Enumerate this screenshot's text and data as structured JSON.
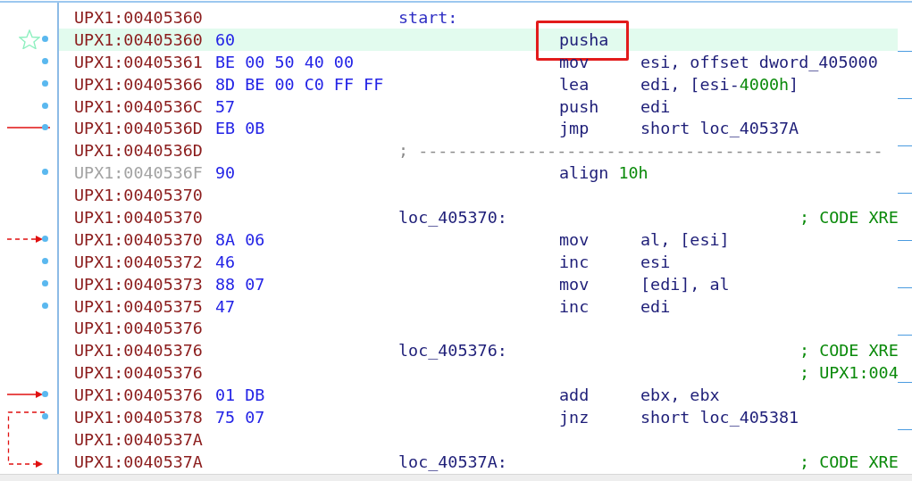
{
  "listing": {
    "rows": [
      {
        "address": "UPX1:00405360",
        "label": "start:"
      },
      {
        "address": "UPX1:00405360",
        "bytes": "60",
        "mnemonic": "pusha",
        "highlighted": true,
        "boxed": true,
        "star": true,
        "dot": true
      },
      {
        "address": "UPX1:00405361",
        "bytes": "BE 00 50 40 00",
        "mnemonic": "mov",
        "operands": [
          {
            "text": "esi, offset dword_405000"
          }
        ],
        "dot": true
      },
      {
        "address": "UPX1:00405366",
        "bytes": "8D BE 00 C0 FF FF",
        "mnemonic": "lea",
        "operands": [
          {
            "text": "edi, [esi-"
          },
          {
            "text": "4000h",
            "kind": "number"
          },
          {
            "text": "]"
          }
        ],
        "dot": true
      },
      {
        "address": "UPX1:0040536C",
        "bytes": "57",
        "mnemonic": "push",
        "operands": [
          {
            "text": "edi"
          }
        ],
        "dot": true
      },
      {
        "address": "UPX1:0040536D",
        "bytes": "EB 0B",
        "mnemonic": "jmp",
        "operands": [
          {
            "text": "short loc_40537A"
          }
        ],
        "dot": true,
        "arrow": {
          "kind": "line-out"
        }
      },
      {
        "address": "UPX1:0040536D",
        "separator": "; -----------------------------------------------"
      },
      {
        "address": "UPX1:0040536F",
        "dimmed": true,
        "bytes": "90",
        "mnemonic": "align",
        "operand_inline": true,
        "operands": [
          {
            "text": "10h",
            "kind": "number"
          }
        ],
        "dot": true
      },
      {
        "address": "UPX1:00405370"
      },
      {
        "address": "UPX1:00405370",
        "label": "loc_405370:",
        "comment": "; CODE XRE"
      },
      {
        "address": "UPX1:00405370",
        "bytes": "8A 06",
        "mnemonic": "mov",
        "operands": [
          {
            "text": "al, [esi]"
          }
        ],
        "dot": true,
        "arrow": {
          "kind": "dashed-in"
        }
      },
      {
        "address": "UPX1:00405372",
        "bytes": "46",
        "mnemonic": "inc",
        "operands": [
          {
            "text": "esi"
          }
        ],
        "dot": true
      },
      {
        "address": "UPX1:00405373",
        "bytes": "88 07",
        "mnemonic": "mov",
        "operands": [
          {
            "text": "[edi], al"
          }
        ],
        "dot": true
      },
      {
        "address": "UPX1:00405375",
        "bytes": "47",
        "mnemonic": "inc",
        "operands": [
          {
            "text": "edi"
          }
        ],
        "dot": true
      },
      {
        "address": "UPX1:00405376"
      },
      {
        "address": "UPX1:00405376",
        "label": "loc_405376:",
        "comment": "; CODE XRE"
      },
      {
        "address": "UPX1:00405376",
        "comment": "; UPX1:004"
      },
      {
        "address": "UPX1:00405376",
        "bytes": "01 DB",
        "mnemonic": "add",
        "operands": [
          {
            "text": "ebx, ebx"
          }
        ],
        "dot": true,
        "arrow": {
          "kind": "solid-in"
        }
      },
      {
        "address": "UPX1:00405378",
        "bytes": "75 07",
        "mnemonic": "jnz",
        "operands": [
          {
            "text": "short loc_405381"
          }
        ],
        "dot": true,
        "arrow": {
          "kind": "dashed-branch"
        }
      },
      {
        "address": "UPX1:0040537A"
      },
      {
        "address": "UPX1:0040537A",
        "label": "loc_40537A:",
        "comment": "; CODE XRE"
      }
    ]
  }
}
